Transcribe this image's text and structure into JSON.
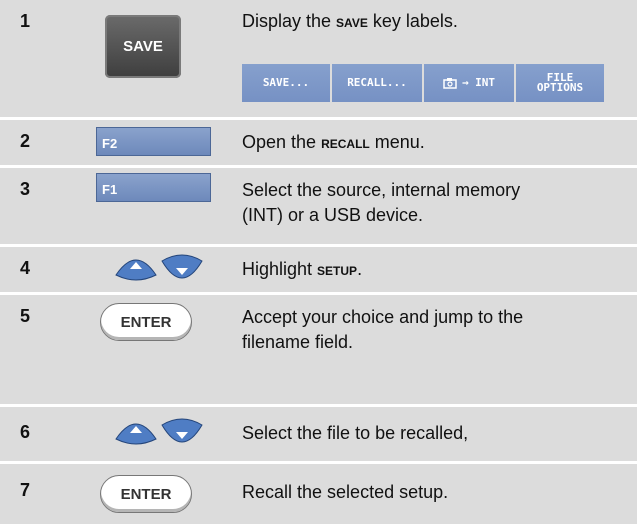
{
  "steps": [
    {
      "num": "1",
      "key": "SAVE",
      "text_a": "Display the ",
      "text_b": "SAVE",
      "text_c": " key labels."
    },
    {
      "num": "2",
      "key": "F2",
      "text_a": "Open the ",
      "text_b": "RECALL",
      "text_c": " menu."
    },
    {
      "num": "3",
      "key": "F1",
      "line1": "Select the source, internal memory",
      "line2": "(INT) or a USB device."
    },
    {
      "num": "4",
      "key": "arrows",
      "text_a": "Highlight ",
      "text_b": "SETUP",
      "text_c": "."
    },
    {
      "num": "5",
      "key": "ENTER",
      "line1": "Accept your choice and jump to the",
      "line2": "filename field."
    },
    {
      "num": "6",
      "key": "arrows",
      "text": "Select the file to be recalled,"
    },
    {
      "num": "7",
      "key": "ENTER",
      "text": "Recall the selected setup."
    }
  ],
  "softkeys": [
    "SAVE...",
    "RECALL...",
    "→ INT",
    "FILE",
    "OPTIONS"
  ],
  "icons": {
    "camera": "camera-icon",
    "up": "arrow-up-icon",
    "down": "arrow-down-icon"
  }
}
